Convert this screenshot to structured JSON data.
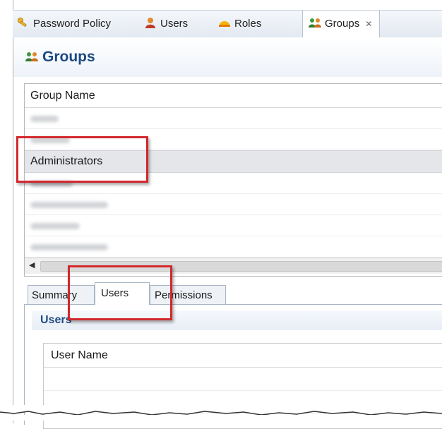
{
  "editor_tabs": [
    {
      "label": "Password Policy",
      "icon": "key-icon"
    },
    {
      "label": "Users",
      "icon": "user-icon"
    },
    {
      "label": "Roles",
      "icon": "role-icon"
    },
    {
      "label": "Groups",
      "icon": "groups-icon",
      "close": "✕",
      "active": true
    }
  ],
  "header": {
    "title": "Groups",
    "icon": "groups-icon"
  },
  "group_table": {
    "column": "Group Name",
    "rows": [
      {
        "name": "",
        "blurred": true
      },
      {
        "name": "",
        "blurred": true
      },
      {
        "name": "Administrators",
        "selected": true
      },
      {
        "name": "",
        "blurred": true
      },
      {
        "name": "",
        "blurred": true
      },
      {
        "name": "",
        "blurred": true
      },
      {
        "name": "",
        "blurred": true
      }
    ],
    "scroll_left": "◀"
  },
  "sub_tabs": [
    {
      "label": "Summary"
    },
    {
      "label": "Users",
      "active": true
    },
    {
      "label": "Permissions"
    }
  ],
  "users_section": {
    "title": "Users",
    "column": "User Name"
  },
  "colors": {
    "accent_blue": "#1d4a82",
    "callout_red": "#d2282d"
  }
}
